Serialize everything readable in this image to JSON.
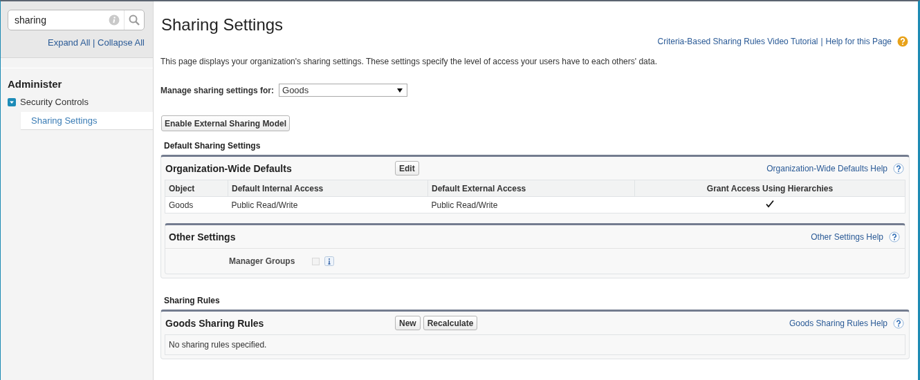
{
  "search": {
    "value": "sharing"
  },
  "tree_links": {
    "items": [
      "Expand All",
      "Collapse All"
    ],
    "separator": "|"
  },
  "sidebar": {
    "heading": "Administer",
    "items": [
      {
        "label": "Security Controls",
        "expanded": true,
        "children": [
          {
            "label": "Sharing Settings",
            "selected": true
          }
        ]
      }
    ]
  },
  "page": {
    "title": "Sharing Settings",
    "help_links": {
      "items": [
        "Criteria-Based Sharing Rules Video Tutorial",
        "Help for this Page"
      ],
      "separator": "|"
    },
    "description": "This page displays your organization's sharing settings. These settings specify the level of access your users have to each others' data.",
    "manage": {
      "label": "Manage sharing settings for:",
      "value": "Goods"
    },
    "buttons": [
      "Enable External Sharing Model"
    ]
  },
  "sections": [
    {
      "heading": "Default Sharing Settings",
      "panel": {
        "title": "Organization-Wide Defaults",
        "buttons": [
          "Edit"
        ],
        "help": "Organization-Wide Defaults Help",
        "table": {
          "columns": [
            "Object",
            "Default Internal Access",
            "Default External Access",
            "Grant Access Using Hierarchies"
          ],
          "rows": [
            {
              "object": "Goods",
              "internal": "Public Read/Write",
              "external": "Public Read/Write",
              "grant_access": true
            }
          ]
        },
        "subpanel": {
          "title": "Other Settings",
          "help": "Other Settings Help",
          "fields": [
            {
              "label": "Manager Groups",
              "checked": false,
              "disabled": true
            }
          ]
        }
      }
    },
    {
      "heading": "Sharing Rules",
      "panel": {
        "title": "Goods Sharing Rules",
        "buttons": [
          "New",
          "Recalculate"
        ],
        "help": "Goods Sharing Rules Help",
        "empty_text": "No sharing rules specified."
      }
    }
  ]
}
